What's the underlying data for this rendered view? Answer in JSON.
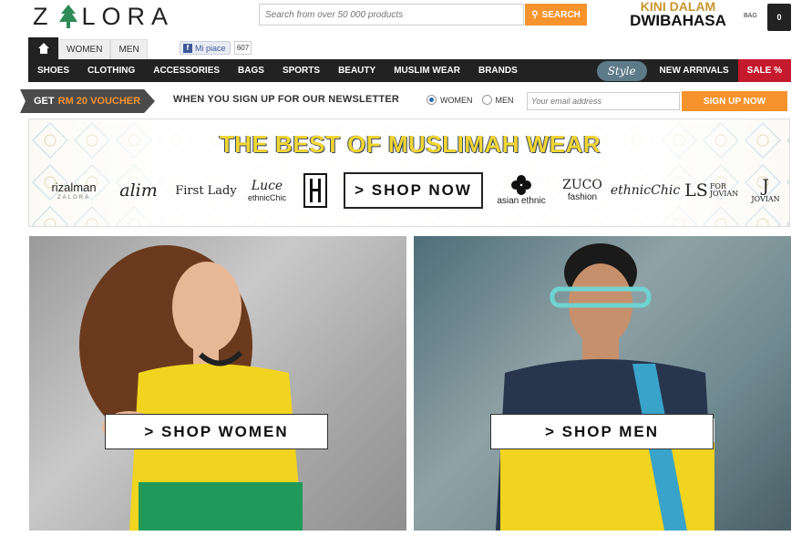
{
  "header": {
    "logo_text": "ZALORA",
    "search_placeholder": "Search from over 50 000 products",
    "search_button": "SEARCH",
    "promo_line1": "KINI DALAM",
    "promo_line2": "DWIBAHASA",
    "bag_label": "BAG",
    "bag_count": "0"
  },
  "gender_tabs": [
    "WOMEN",
    "MEN"
  ],
  "social": {
    "fb_label": "Mi piace",
    "fb_count": "607"
  },
  "nav": {
    "items": [
      "SHOES",
      "CLOTHING",
      "ACCESSORIES",
      "BAGS",
      "SPORTS",
      "BEAUTY",
      "MUSLIM WEAR",
      "BRANDS"
    ],
    "style_label": "Style",
    "new_arrivals": "NEW ARRIVALS",
    "sale": "SALE %"
  },
  "newsletter": {
    "voucher_prefix": "GET",
    "voucher_amount": "RM 20 VOUCHER",
    "text": "WHEN YOU SIGN UP FOR OUR NEWSLETTER",
    "option_women": "WOMEN",
    "option_men": "MEN",
    "selected": "WOMEN",
    "email_placeholder": "Your email address",
    "button": "SIGN UP NOW"
  },
  "banner": {
    "title": "THE BEST OF MUSLIMAH WEAR",
    "shop_now": "> SHOP NOW",
    "brands": {
      "rizalman": "rizalman",
      "rizalman_sub": "ZALORA",
      "alim": "alim",
      "firstlady": "First Lady",
      "luce": "Luce",
      "luce_sub": "ethnicChic",
      "asian": "asian ethnic",
      "zuco": "ZUCO",
      "zuco_sub": "fashion",
      "ethnic": "ethnicChic",
      "ls": "LS",
      "ls_sub": "FOR JOVIAN",
      "jovian": "JOVIAN"
    }
  },
  "panels": {
    "women_button": "> SHOP WOMEN",
    "men_button": "> SHOP MEN"
  },
  "colors": {
    "accent": "#f6932d",
    "nav_bg": "#222222",
    "sale": "#c5192d",
    "banner_title": "#f1d535"
  }
}
